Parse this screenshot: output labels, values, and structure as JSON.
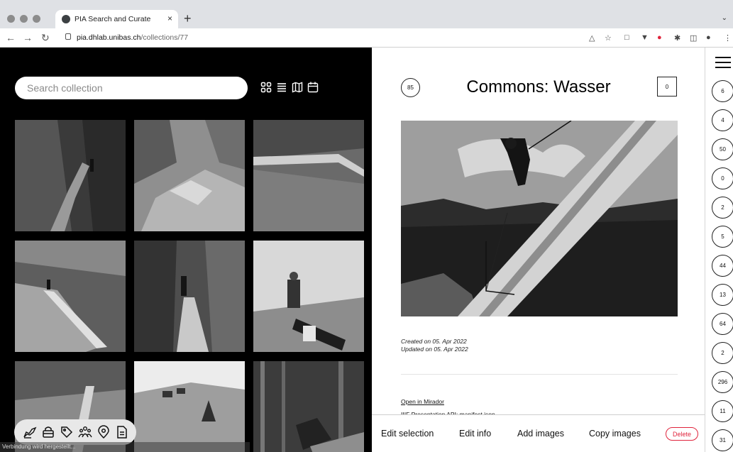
{
  "browser": {
    "tab_title": "PIA Search and Curate",
    "tab_close": "×",
    "new_tab": "+",
    "url_host": "pia.dhlab.unibas.ch",
    "url_path": "/collections/77"
  },
  "search": {
    "placeholder": "Search collection"
  },
  "view_modes": [
    "grid-icon",
    "list-icon",
    "map-icon",
    "calendar-icon"
  ],
  "thumbnails": [
    {
      "alt": "Gorge path with wooden walkway"
    },
    {
      "alt": "Rocky slope with stones"
    },
    {
      "alt": "Wooden channel along cliff"
    },
    {
      "alt": "Water channel in rocky valley"
    },
    {
      "alt": "Person on plank walkway in gorge"
    },
    {
      "alt": "Worker fitting pipe"
    },
    {
      "alt": "Meadow slope with channel"
    },
    {
      "alt": "Alpine pasture with huts"
    },
    {
      "alt": "Workers in forest"
    }
  ],
  "toolbar_icons": [
    "curate-icon",
    "bag-icon",
    "tag-icon",
    "people-icon",
    "location-icon",
    "document-icon"
  ],
  "status_text": "Verbindung wird hergestellt...",
  "detail": {
    "image_count": "85",
    "title": "Commons: Wasser",
    "selection_count": "0",
    "created": "Created on 05. Apr 2022",
    "updated": "Updated on 05. Apr 2022",
    "open_mirador": "Open in Mirador",
    "iiif_link": "IIIF Presentation API: manifest.json",
    "actions": {
      "edit_selection": "Edit selection",
      "edit_info": "Edit info",
      "add_images": "Add images",
      "copy_images": "Copy images",
      "delete": "Delete"
    }
  },
  "collection_counts": [
    "6",
    "4",
    "50",
    "0",
    "2",
    "5",
    "44",
    "13",
    "64",
    "2",
    "296",
    "11",
    "31"
  ],
  "colors": {
    "panel_bg": "#000000",
    "delete": "#e0243c"
  }
}
